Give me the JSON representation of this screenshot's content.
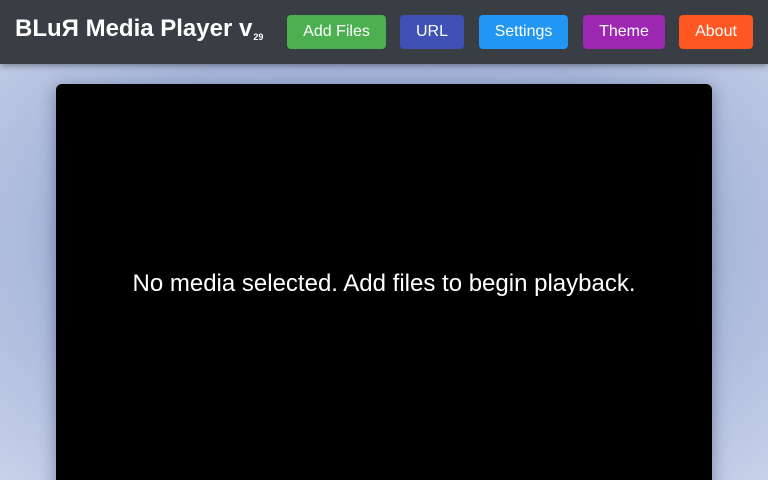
{
  "app": {
    "title": "BLuЯ Media Player v",
    "version": "29"
  },
  "toolbar": {
    "add_files": {
      "label": "Add Files",
      "color": "#4caf50"
    },
    "url": {
      "label": "URL",
      "color": "#3f51b5"
    },
    "settings": {
      "label": "Settings",
      "color": "#2196f3"
    },
    "theme": {
      "label": "Theme",
      "color": "#9c27b0"
    },
    "about": {
      "label": "About",
      "color": "#ff5722"
    }
  },
  "player": {
    "placeholder": "No media selected. Add files to begin playback."
  },
  "colors": {
    "header_bg": "#393d44",
    "page_bg": "#a6b5d9",
    "player_bg": "#000000"
  }
}
